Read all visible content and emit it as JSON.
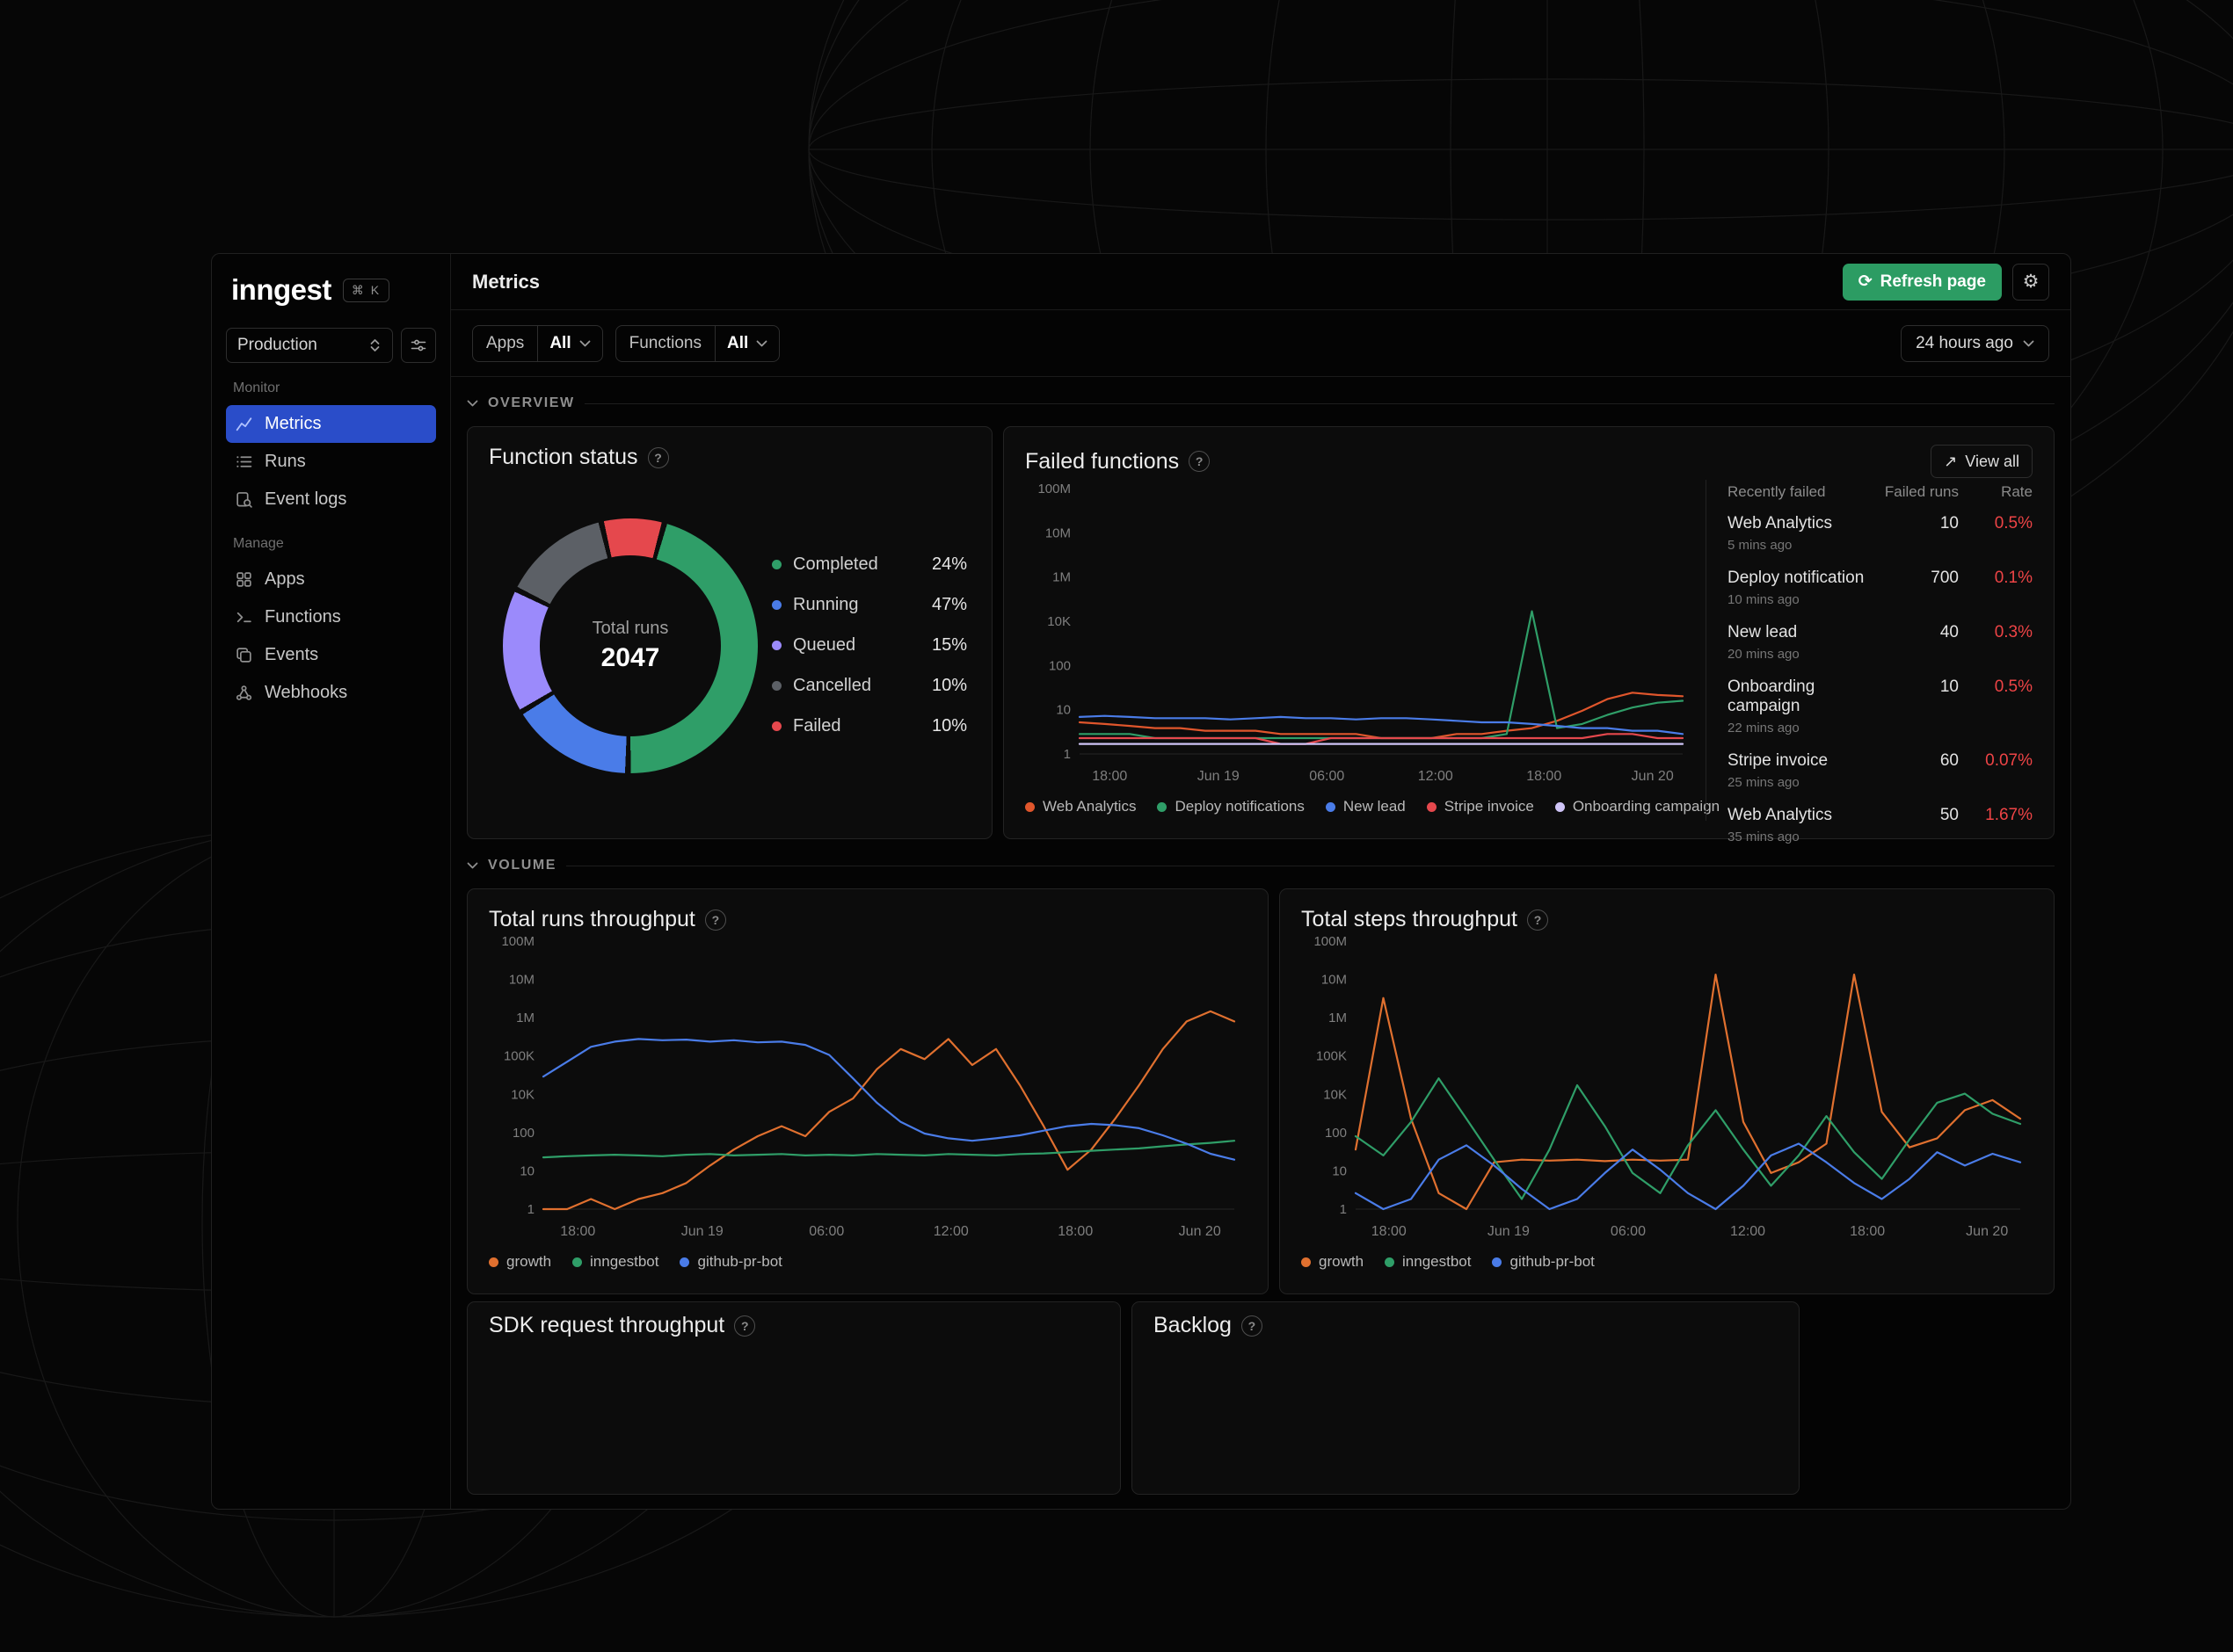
{
  "app": {
    "logo": "inngest",
    "shortcut": "⌘ K"
  },
  "icons": {
    "refresh": "⟳",
    "gear": "⚙",
    "view_all_arrow": "↗",
    "info": "?"
  },
  "sidebar": {
    "environment": "Production",
    "monitor_label": "Monitor",
    "manage_label": "Manage",
    "monitor_items": [
      {
        "label": "Metrics"
      },
      {
        "label": "Runs"
      },
      {
        "label": "Event logs"
      }
    ],
    "manage_items": [
      {
        "label": "Apps"
      },
      {
        "label": "Functions"
      },
      {
        "label": "Events"
      },
      {
        "label": "Webhooks"
      }
    ]
  },
  "header": {
    "title": "Metrics",
    "refresh_button": "Refresh page"
  },
  "filters": {
    "apps_label": "Apps",
    "apps_value": "All",
    "functions_label": "Functions",
    "functions_value": "All",
    "time_range": "24 hours ago"
  },
  "sections": {
    "overview": "OVERVIEW",
    "volume": "VOLUME"
  },
  "function_status": {
    "title": "Function status",
    "center_label": "Total runs",
    "center_value": "2047",
    "legend": [
      {
        "label": "Completed",
        "value": "24%",
        "color": "#2f9e68"
      },
      {
        "label": "Running",
        "value": "47%",
        "color": "#4a7ce8"
      },
      {
        "label": "Queued",
        "value": "15%",
        "color": "#9b8afb"
      },
      {
        "label": "Cancelled",
        "value": "10%",
        "color": "#5c6066"
      },
      {
        "label": "Failed",
        "value": "10%",
        "color": "#e5484d"
      }
    ]
  },
  "failed_functions": {
    "title": "Failed functions",
    "view_all": "View all",
    "table": {
      "col_name": "Recently failed",
      "col_runs": "Failed runs",
      "col_rate": "Rate",
      "rows": [
        {
          "name": "Web Analytics",
          "ago": "5 mins ago",
          "runs": "10",
          "rate": "0.5%"
        },
        {
          "name": "Deploy notification",
          "ago": "10 mins ago",
          "runs": "700",
          "rate": "0.1%"
        },
        {
          "name": "New lead",
          "ago": "20 mins ago",
          "runs": "40",
          "rate": "0.3%"
        },
        {
          "name": "Onboarding campaign",
          "ago": "22 mins ago",
          "runs": "10",
          "rate": "0.5%"
        },
        {
          "name": "Stripe invoice",
          "ago": "25 mins ago",
          "runs": "60",
          "rate": "0.07%"
        },
        {
          "name": "Web Analytics",
          "ago": "35 mins ago",
          "runs": "50",
          "rate": "1.67%"
        }
      ]
    }
  },
  "volume_cards": {
    "total_runs_title": "Total runs throughput",
    "total_steps_title": "Total steps throughput",
    "sdk_title": "SDK request throughput",
    "backlog_title": "Backlog"
  },
  "chart_data": [
    {
      "id": "function-status-donut",
      "type": "pie",
      "title": "Function status",
      "center_label": "Total runs",
      "center_value": 2047,
      "legend_percentages": {
        "Completed": 24,
        "Running": 47,
        "Queued": 15,
        "Cancelled": 10,
        "Failed": 10
      },
      "segments": [
        {
          "label": "Failed",
          "color": "#e5484d",
          "sweep": 8
        },
        {
          "label": "Completed",
          "color": "#2f9e68",
          "sweep": 46
        },
        {
          "label": "Running",
          "color": "#4a7ce8",
          "sweep": 16
        },
        {
          "label": "Queued",
          "color": "#9b8afb",
          "sweep": 16
        },
        {
          "label": "Cancelled",
          "color": "#5c6066",
          "sweep": 14
        }
      ]
    },
    {
      "id": "failed-functions",
      "type": "line",
      "title": "Failed functions",
      "x_ticks": [
        "18:00",
        "Jun 19",
        "06:00",
        "12:00",
        "18:00",
        "Jun 20"
      ],
      "y_ticks": [
        "100M",
        "10M",
        "1M",
        "10K",
        "100",
        "10",
        "1"
      ],
      "log_max_exp": 8,
      "legend_position": "bottom",
      "series": [
        {
          "name": "Web Analytics",
          "color": "#e0562c",
          "values": [
            9,
            8,
            7,
            6,
            6,
            5,
            5,
            5,
            4,
            4,
            4,
            4,
            3,
            3,
            3,
            4,
            4,
            5,
            6,
            10,
            20,
            45,
            70,
            60,
            55
          ]
        },
        {
          "name": "Deploy notifications",
          "color": "#2f9e68",
          "values": [
            4,
            4,
            4,
            3,
            3,
            3,
            3,
            3,
            3,
            3,
            3,
            3,
            3,
            3,
            3,
            3,
            3,
            4,
            20000,
            6,
            8,
            15,
            25,
            35,
            40
          ]
        },
        {
          "name": "New lead",
          "color": "#4a7ce8",
          "values": [
            13,
            14,
            13,
            12,
            12,
            12,
            11,
            12,
            13,
            12,
            12,
            11,
            12,
            12,
            11,
            10,
            9,
            9,
            8,
            7,
            6,
            6,
            5,
            5,
            4
          ]
        },
        {
          "name": "Stripe invoice",
          "color": "#e5484d",
          "values": [
            3,
            3,
            3,
            3,
            3,
            3,
            3,
            3,
            2,
            2,
            3,
            3,
            3,
            3,
            3,
            3,
            3,
            3,
            3,
            3,
            3,
            4,
            4,
            3,
            3
          ]
        },
        {
          "name": "Onboarding campaign",
          "color": "#cfc4f7",
          "values": [
            2,
            2,
            2,
            2,
            2,
            2,
            2,
            2,
            2,
            2,
            2,
            2,
            2,
            2,
            2,
            2,
            2,
            2,
            2,
            2,
            2,
            2,
            2,
            2,
            2
          ]
        }
      ]
    },
    {
      "id": "total-runs-throughput",
      "type": "line",
      "title": "Total runs throughput",
      "x_ticks": [
        "18:00",
        "Jun 19",
        "06:00",
        "12:00",
        "18:00",
        "Jun 20"
      ],
      "y_ticks": [
        "100M",
        "10M",
        "1M",
        "100K",
        "10K",
        "100",
        "10",
        "1"
      ],
      "log_max_exp": 8,
      "legend_position": "bottom",
      "series": [
        {
          "name": "growth",
          "color": "#e0702f",
          "values": [
            1,
            1,
            2,
            1,
            2,
            3,
            6,
            20,
            60,
            150,
            300,
            150,
            800,
            2000,
            15000,
            60000,
            30000,
            120000,
            20000,
            60000,
            5000,
            300,
            15,
            60,
            500,
            5000,
            60000,
            400000,
            800000,
            400000
          ]
        },
        {
          "name": "inngestbot",
          "color": "#2f9e68",
          "values": [
            35,
            38,
            40,
            42,
            40,
            38,
            42,
            44,
            40,
            42,
            44,
            40,
            42,
            40,
            44,
            42,
            40,
            44,
            42,
            40,
            44,
            46,
            50,
            55,
            60,
            65,
            75,
            85,
            95,
            110
          ]
        },
        {
          "name": "github-pr-bot",
          "color": "#4a7ce8",
          "values": [
            9000,
            25000,
            70000,
            100000,
            120000,
            110000,
            115000,
            100000,
            110000,
            95000,
            100000,
            80000,
            40000,
            8000,
            1500,
            400,
            180,
            130,
            110,
            130,
            160,
            220,
            300,
            350,
            320,
            260,
            160,
            90,
            45,
            30
          ]
        }
      ]
    },
    {
      "id": "total-steps-throughput",
      "type": "line",
      "title": "Total steps throughput",
      "x_ticks": [
        "18:00",
        "Jun 19",
        "06:00",
        "12:00",
        "18:00",
        "Jun 20"
      ],
      "y_ticks": [
        "100M",
        "10M",
        "1M",
        "100K",
        "10K",
        "100",
        "10",
        "1"
      ],
      "log_max_exp": 8,
      "legend_position": "bottom",
      "series": [
        {
          "name": "growth",
          "color": "#e0702f",
          "values": [
            60,
            2000000,
            500,
            3,
            1,
            25,
            30,
            28,
            30,
            27,
            30,
            28,
            30,
            10000000,
            400,
            12,
            25,
            90,
            10000000,
            800,
            70,
            130,
            900,
            1800,
            500
          ]
        },
        {
          "name": "inngestbot",
          "color": "#2f9e68",
          "values": [
            150,
            40,
            400,
            8000,
            500,
            30,
            2,
            60,
            5000,
            300,
            12,
            3,
            80,
            900,
            60,
            5,
            40,
            600,
            50,
            8,
            120,
            1500,
            2800,
            700,
            350
          ]
        },
        {
          "name": "github-pr-bot",
          "color": "#4a7ce8",
          "values": [
            3,
            1,
            2,
            30,
            80,
            20,
            4,
            1,
            2,
            12,
            60,
            15,
            3,
            1,
            5,
            40,
            90,
            25,
            6,
            2,
            8,
            50,
            20,
            45,
            25
          ]
        }
      ]
    }
  ]
}
